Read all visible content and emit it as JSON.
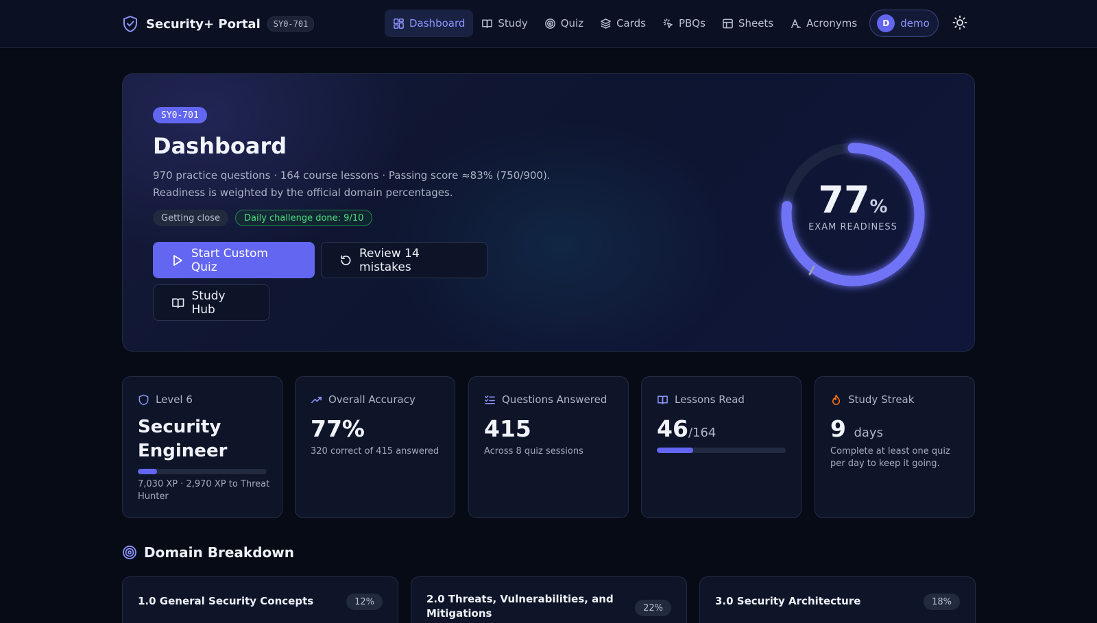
{
  "brand": {
    "title": "Security+ Portal",
    "badge": "SY0-701"
  },
  "nav": {
    "items": [
      {
        "label": "Dashboard",
        "icon": "dashboard-icon",
        "active": true
      },
      {
        "label": "Study",
        "icon": "book-icon"
      },
      {
        "label": "Quiz",
        "icon": "target-icon"
      },
      {
        "label": "Cards",
        "icon": "layers-icon"
      },
      {
        "label": "PBQs",
        "icon": "cursor-click-icon"
      },
      {
        "label": "Sheets",
        "icon": "table-icon"
      },
      {
        "label": "Acronyms",
        "icon": "text-a-icon"
      }
    ],
    "user": {
      "initial": "D",
      "name": "demo"
    }
  },
  "hero": {
    "badge": "SY0-701",
    "title": "Dashboard",
    "description": "970 practice questions · 164 course lessons · Passing score ≈83% (750/900). Readiness is weighted by the official domain percentages.",
    "tags": [
      "Getting close",
      "Daily challenge done: 9/10"
    ],
    "buttons": {
      "start_quiz": "Start Custom Quiz",
      "review": "Review 14 mistakes",
      "study_hub": "Study Hub"
    },
    "readiness": {
      "value": "77",
      "unit": "%",
      "label": "EXAM READINESS",
      "fraction": 0.77
    }
  },
  "stats": {
    "level": {
      "label": "Level 6",
      "rank": "Security Engineer",
      "xp_text": "7,030 XP · 2,970 XP to Threat Hunter",
      "progress": 0.15
    },
    "accuracy": {
      "label": "Overall Accuracy",
      "value": "77%",
      "detail": "320 correct of 415 answered"
    },
    "answered": {
      "label": "Questions Answered",
      "value": "415",
      "detail": "Across 8 quiz sessions"
    },
    "lessons": {
      "label": "Lessons Read",
      "value": "46",
      "total": "/164",
      "progress": 0.28
    },
    "streak": {
      "label": "Study Streak",
      "value": "9",
      "unit": "days",
      "detail": "Complete at least one quiz per day to keep it going."
    }
  },
  "domains": {
    "title": "Domain Breakdown",
    "items": [
      {
        "name": "1.0 General Security Concepts",
        "weight": "12%"
      },
      {
        "name": "2.0 Threats, Vulnerabilities, and Mitigations",
        "weight": "22%"
      },
      {
        "name": "3.0 Security Architecture",
        "weight": "18%"
      }
    ]
  },
  "colors": {
    "accent": "#6366f1",
    "accent_text": "#8d95ff",
    "success": "#4ade80",
    "streak": "#f97316"
  }
}
